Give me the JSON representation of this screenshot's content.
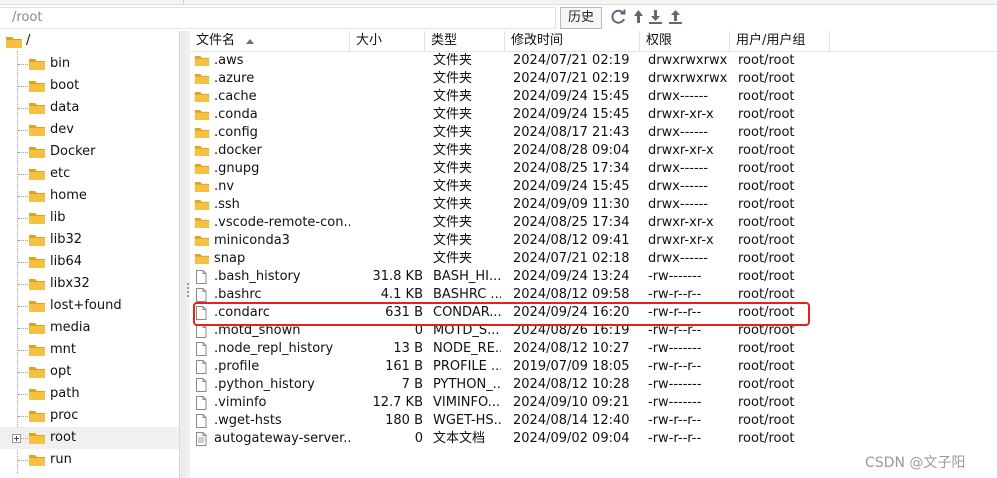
{
  "path": {
    "value": "/root"
  },
  "toolbar": {
    "history_label": "历史",
    "icons": [
      "refresh-icon",
      "upload-icon",
      "download-icon",
      "upload-to-icon"
    ]
  },
  "tree": {
    "root_label": "/",
    "items": [
      {
        "label": "bin"
      },
      {
        "label": "boot"
      },
      {
        "label": "data"
      },
      {
        "label": "dev"
      },
      {
        "label": "Docker"
      },
      {
        "label": "etc"
      },
      {
        "label": "home"
      },
      {
        "label": "lib"
      },
      {
        "label": "lib32"
      },
      {
        "label": "lib64"
      },
      {
        "label": "libx32"
      },
      {
        "label": "lost+found"
      },
      {
        "label": "media"
      },
      {
        "label": "mnt"
      },
      {
        "label": "opt"
      },
      {
        "label": "path"
      },
      {
        "label": "proc"
      },
      {
        "label": "root"
      },
      {
        "label": "run"
      }
    ],
    "selected": "root"
  },
  "columns": {
    "name": "文件名",
    "size": "大小",
    "type": "类型",
    "mtime": "修改时间",
    "perm": "权限",
    "owner": "用户/用户组"
  },
  "files": [
    {
      "name": ".aws",
      "icon": "folder",
      "size": "",
      "type": "文件夹",
      "mtime": "2024/07/21 02:19",
      "perm": "drwxrwxrwx",
      "owner": "root/root"
    },
    {
      "name": ".azure",
      "icon": "folder",
      "size": "",
      "type": "文件夹",
      "mtime": "2024/07/21 02:19",
      "perm": "drwxrwxrwx",
      "owner": "root/root"
    },
    {
      "name": ".cache",
      "icon": "folder",
      "size": "",
      "type": "文件夹",
      "mtime": "2024/09/24 15:45",
      "perm": "drwx------",
      "owner": "root/root"
    },
    {
      "name": ".conda",
      "icon": "folder",
      "size": "",
      "type": "文件夹",
      "mtime": "2024/09/24 15:45",
      "perm": "drwxr-xr-x",
      "owner": "root/root"
    },
    {
      "name": ".config",
      "icon": "folder",
      "size": "",
      "type": "文件夹",
      "mtime": "2024/08/17 21:43",
      "perm": "drwx------",
      "owner": "root/root"
    },
    {
      "name": ".docker",
      "icon": "folder",
      "size": "",
      "type": "文件夹",
      "mtime": "2024/08/28 09:04",
      "perm": "drwxr-xr-x",
      "owner": "root/root"
    },
    {
      "name": ".gnupg",
      "icon": "folder",
      "size": "",
      "type": "文件夹",
      "mtime": "2024/08/25 17:34",
      "perm": "drwx------",
      "owner": "root/root"
    },
    {
      "name": ".nv",
      "icon": "folder",
      "size": "",
      "type": "文件夹",
      "mtime": "2024/09/24 15:45",
      "perm": "drwx------",
      "owner": "root/root"
    },
    {
      "name": ".ssh",
      "icon": "folder",
      "size": "",
      "type": "文件夹",
      "mtime": "2024/09/09 11:30",
      "perm": "drwx------",
      "owner": "root/root"
    },
    {
      "name": ".vscode-remote-con...",
      "icon": "folder",
      "size": "",
      "type": "文件夹",
      "mtime": "2024/08/25 17:34",
      "perm": "drwxr-xr-x",
      "owner": "root/root"
    },
    {
      "name": "miniconda3",
      "icon": "folder",
      "size": "",
      "type": "文件夹",
      "mtime": "2024/08/12 09:41",
      "perm": "drwxr-xr-x",
      "owner": "root/root"
    },
    {
      "name": "snap",
      "icon": "folder",
      "size": "",
      "type": "文件夹",
      "mtime": "2024/07/21 02:18",
      "perm": "drwx------",
      "owner": "root/root"
    },
    {
      "name": ".bash_history",
      "icon": "file",
      "size": "31.8 KB",
      "type": "BASH_HI...",
      "mtime": "2024/09/24 13:24",
      "perm": "-rw-------",
      "owner": "root/root"
    },
    {
      "name": ".bashrc",
      "icon": "file",
      "size": "4.1 KB",
      "type": "BASHRC ...",
      "mtime": "2024/08/12 09:58",
      "perm": "-rw-r--r--",
      "owner": "root/root"
    },
    {
      "name": ".condarc",
      "icon": "file",
      "size": "631 B",
      "type": "CONDAR...",
      "mtime": "2024/09/24 16:20",
      "perm": "-rw-r--r--",
      "owner": "root/root"
    },
    {
      "name": ".motd_shown",
      "icon": "file",
      "size": "0",
      "type": "MOTD_S...",
      "mtime": "2024/08/26 16:19",
      "perm": "-rw-r--r--",
      "owner": "root/root"
    },
    {
      "name": ".node_repl_history",
      "icon": "file",
      "size": "13 B",
      "type": "NODE_RE...",
      "mtime": "2024/08/12 10:27",
      "perm": "-rw-------",
      "owner": "root/root"
    },
    {
      "name": ".profile",
      "icon": "file",
      "size": "161 B",
      "type": "PROFILE ...",
      "mtime": "2019/07/09 18:05",
      "perm": "-rw-r--r--",
      "owner": "root/root"
    },
    {
      "name": ".python_history",
      "icon": "file",
      "size": "7 B",
      "type": "PYTHON_...",
      "mtime": "2024/08/12 10:28",
      "perm": "-rw-------",
      "owner": "root/root"
    },
    {
      "name": ".viminfo",
      "icon": "file",
      "size": "12.7 KB",
      "type": "VIMINFO...",
      "mtime": "2024/09/10 09:21",
      "perm": "-rw-------",
      "owner": "root/root"
    },
    {
      "name": ".wget-hsts",
      "icon": "file",
      "size": "180 B",
      "type": "WGET-HS...",
      "mtime": "2024/08/14 12:40",
      "perm": "-rw-r--r--",
      "owner": "root/root"
    },
    {
      "name": "autogateway-server...",
      "icon": "textfile",
      "size": "0",
      "type": "文本文档",
      "mtime": "2024/09/02 09:04",
      "perm": "-rw-r--r--",
      "owner": "root/root"
    }
  ],
  "highlighted_file": ".condarc",
  "watermark": "CSDN @文子阳",
  "colors": {
    "folder": "#f6c043",
    "folder_dark": "#dba41c",
    "highlight": "#e8201c",
    "selected_row": "#f0f0f0"
  }
}
